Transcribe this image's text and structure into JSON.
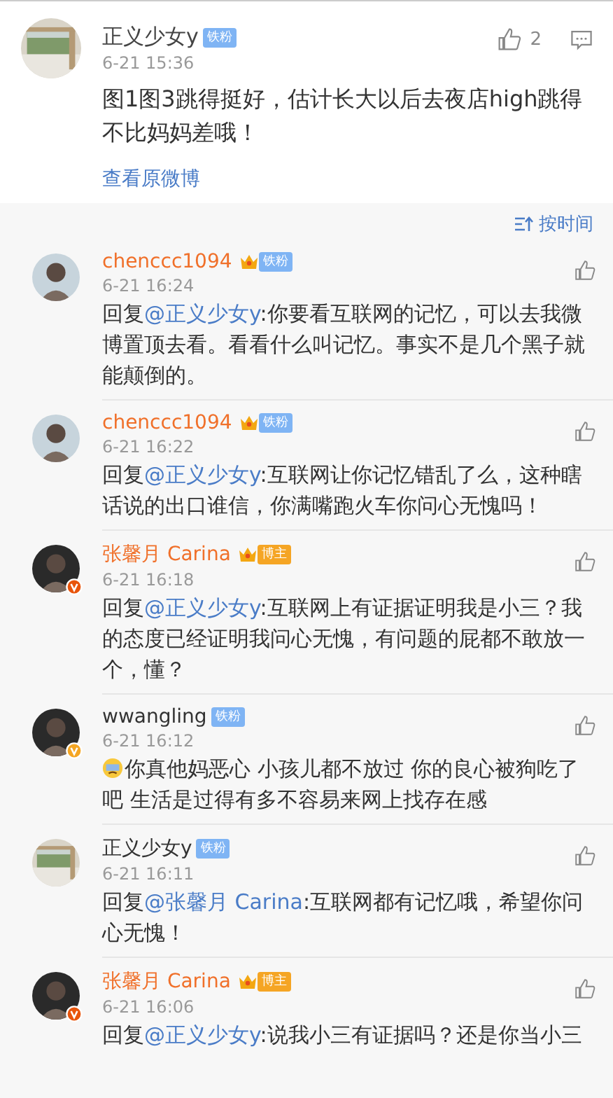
{
  "post": {
    "author": "正义少女y",
    "badge": {
      "kind": "fan",
      "label": "铁粉"
    },
    "time": "6-21 15:36",
    "likes": "2",
    "text": "图1图3跳得挺好，估计长大以后去夜店high跳得不比妈妈差哦！",
    "link": "查看原微博"
  },
  "sort": {
    "label": "按时间"
  },
  "comments": [
    {
      "author": "chenccc1094",
      "vip": true,
      "badge": {
        "kind": "fan",
        "label": "铁粉"
      },
      "time": "6-21 16:24",
      "reply": "回复",
      "mention": "@正义少女y",
      "emoji": false,
      "text": ":你要看互联网的记忆，可以去我微博置顶去看。看看什么叫记忆。事实不是几个黑子就能颠倒的。"
    },
    {
      "author": "chenccc1094",
      "vip": true,
      "badge": {
        "kind": "fan",
        "label": "铁粉"
      },
      "time": "6-21 16:22",
      "reply": "回复",
      "mention": "@正义少女y",
      "emoji": false,
      "text": ":互联网让你记忆错乱了么，这种瞎话说的出口谁信，你满嘴跑火车你问心无愧吗！"
    },
    {
      "author": "张馨月 Carina",
      "vip": true,
      "verified": {
        "color": "#e8550c"
      },
      "badge": {
        "kind": "host",
        "label": "博主"
      },
      "time": "6-21 16:18",
      "reply": "回复",
      "mention": "@正义少女y",
      "emoji": false,
      "text": ":互联网上有证据证明我是小三？我的态度已经证明我问心无愧，有问题的屁都不敢放一个，懂？"
    },
    {
      "author": "wwangling",
      "vip": false,
      "verified": {
        "color": "#f5a623"
      },
      "badge": {
        "kind": "fan",
        "label": "铁粉"
      },
      "time": "6-21 16:12",
      "emoji": true,
      "text": "你真他妈恶心 小孩儿都不放过 你的良心被狗吃了吧 生活是过得有多不容易来网上找存在感"
    },
    {
      "author": "正义少女y",
      "vip": false,
      "badge": {
        "kind": "fan",
        "label": "铁粉"
      },
      "time": "6-21 16:11",
      "reply": "回复",
      "mention": "@张馨月 Carina",
      "emoji": false,
      "text": ":互联网都有记忆哦，希望你问心无愧！"
    },
    {
      "author": "张馨月 Carina",
      "vip": true,
      "verified": {
        "color": "#e8550c"
      },
      "badge": {
        "kind": "host",
        "label": "博主"
      },
      "time": "6-21 16:06",
      "reply": "回复",
      "mention": "@正义少女y",
      "emoji": false,
      "text": ":说我小三有证据吗？还是你当小三"
    }
  ]
}
